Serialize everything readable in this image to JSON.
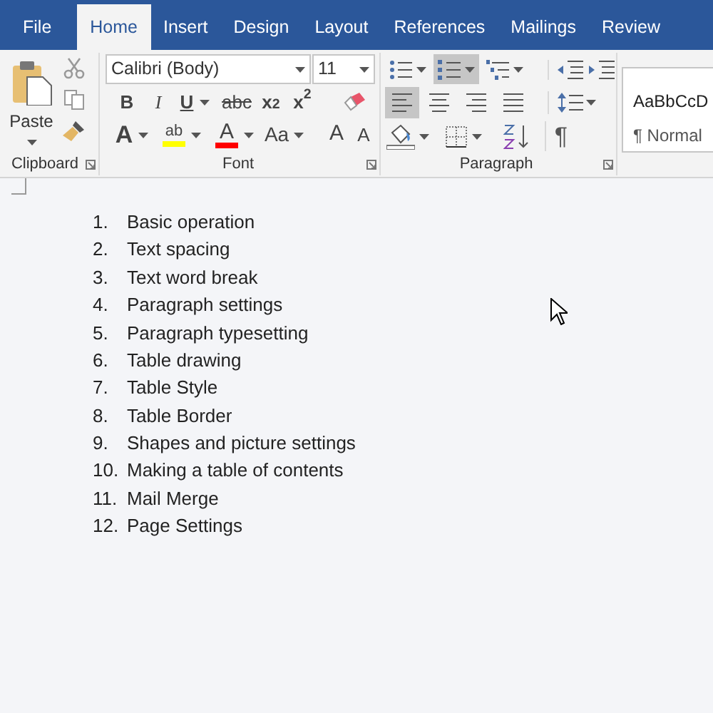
{
  "tabs": [
    {
      "label": "File",
      "selected": false
    },
    {
      "label": "Home",
      "selected": true
    },
    {
      "label": "Insert",
      "selected": false
    },
    {
      "label": "Design",
      "selected": false
    },
    {
      "label": "Layout",
      "selected": false
    },
    {
      "label": "References",
      "selected": false
    },
    {
      "label": "Mailings",
      "selected": false
    },
    {
      "label": "Review",
      "selected": false
    }
  ],
  "clipboard": {
    "paste": "Paste",
    "label": "Clipboard"
  },
  "font": {
    "name": "Calibri (Body)",
    "size": "11",
    "bold": "B",
    "italic": "I",
    "underline": "U",
    "strikethrough": "abc",
    "subscript": "x$_{2}$",
    "superscript": "x$^{2}$",
    "text_effects": "A",
    "highlight": "ab",
    "font_color": "A",
    "change_case": "Aa",
    "grow": "A",
    "shrink": "A",
    "label": "Font"
  },
  "paragraph": {
    "lists": [
      {
        "kind": "bullets",
        "selected": false
      },
      {
        "kind": "numbering",
        "selected": true
      },
      {
        "kind": "multilevel",
        "selected": false
      }
    ],
    "align": [
      {
        "kind": "left",
        "selected": true
      },
      {
        "kind": "center",
        "selected": false
      },
      {
        "kind": "right",
        "selected": false
      },
      {
        "kind": "justify",
        "selected": false
      }
    ],
    "show_marks": "¶",
    "label": "Paragraph"
  },
  "styles": {
    "preview": "AaBbCcD",
    "name": "¶ Normal"
  },
  "document": {
    "list": [
      {
        "number": "1.",
        "text": "Basic operation"
      },
      {
        "number": "2.",
        "text": "Text spacing"
      },
      {
        "number": "3.",
        "text": "Text word break"
      },
      {
        "number": "4.",
        "text": "Paragraph settings"
      },
      {
        "number": "5.",
        "text": "Paragraph typesetting"
      },
      {
        "number": "6.",
        "text": "Table drawing"
      },
      {
        "number": "7.",
        "text": "Table Style"
      },
      {
        "number": "8.",
        "text": "Table Border"
      },
      {
        "number": "9.",
        "text": "Shapes and picture settings"
      },
      {
        "number": "10.",
        "text": "Making a table of contents"
      },
      {
        "number": "11.",
        "text": "Mail Merge"
      },
      {
        "number": "12.",
        "text": "Page Settings"
      }
    ]
  }
}
